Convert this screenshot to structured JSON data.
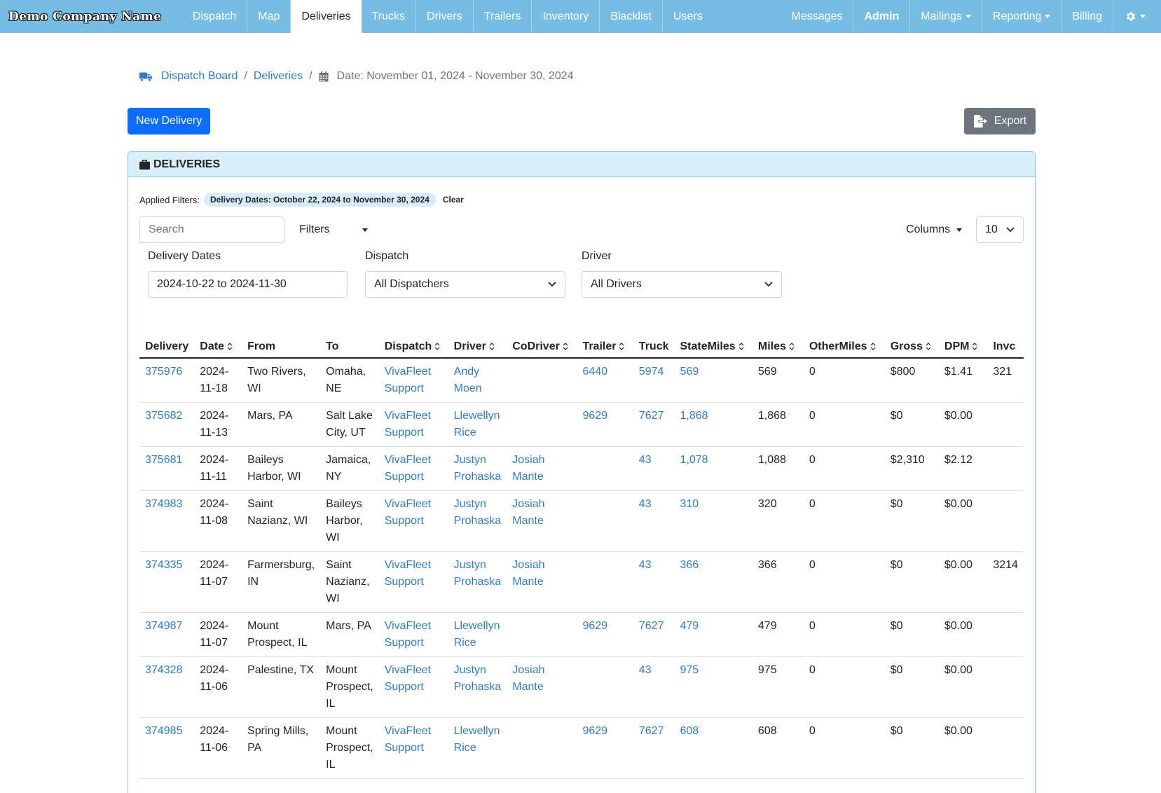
{
  "nav": {
    "brand": "Demo Company Name",
    "left_items": [
      "Dispatch",
      "Map",
      "Deliveries",
      "Trucks",
      "Drivers",
      "Trailers",
      "Inventory",
      "Blacklist",
      "Users"
    ],
    "active": "Deliveries",
    "right_items": [
      "Messages",
      "Admin",
      "Mailings",
      "Reporting",
      "Billing"
    ]
  },
  "breadcrumb": {
    "dispatch_board": "Dispatch Board",
    "deliveries": "Deliveries",
    "date_range": "Date: November 01, 2024 - November 30, 2024"
  },
  "actions": {
    "new_delivery": "New Delivery",
    "export": "Export"
  },
  "card": {
    "title": "DELIVERIES",
    "applied_label": "Applied Filters:",
    "applied_chip": "Delivery Dates: October 22, 2024 to November 30, 2024",
    "clear_label": "Clear",
    "search_placeholder": "Search",
    "filters_label": "Filters",
    "columns_label": "Columns",
    "page_size": "10",
    "delivery_dates_label": "Delivery Dates",
    "delivery_dates_value": "2024-10-22 to 2024-11-30",
    "dispatch_label": "Dispatch",
    "dispatch_value": "All Dispatchers",
    "driver_label": "Driver",
    "driver_value": "All Drivers"
  },
  "table": {
    "columns": [
      "Delivery",
      "Date",
      "From",
      "To",
      "Dispatch",
      "Driver",
      "CoDriver",
      "Trailer",
      "Truck",
      "StateMiles",
      "Miles",
      "OtherMiles",
      "Gross",
      "DPM",
      "Invc"
    ],
    "rows": [
      {
        "delivery": "375976",
        "date": "2024-11-18",
        "from": "Two Rivers, WI",
        "to": "Omaha, NE",
        "dispatch": "VivaFleet Support",
        "driver": "Andy Moen",
        "codriver": "",
        "trailer": "6440",
        "truck": "5974",
        "statemiles": "569",
        "miles": "569",
        "othermiles": "0",
        "gross": "$800",
        "dpm": "$1.41",
        "invoice": "321"
      },
      {
        "delivery": "375682",
        "date": "2024-11-13",
        "from": "Mars, PA",
        "to": "Salt Lake City, UT",
        "dispatch": "VivaFleet Support",
        "driver": "Llewellyn Rice",
        "codriver": "",
        "trailer": "9629",
        "truck": "7627",
        "statemiles": "1,868",
        "miles": "1,868",
        "othermiles": "0",
        "gross": "$0",
        "dpm": "$0.00",
        "invoice": ""
      },
      {
        "delivery": "375681",
        "date": "2024-11-11",
        "from": "Baileys Harbor, WI",
        "to": "Jamaica, NY",
        "dispatch": "VivaFleet Support",
        "driver": "Justyn Prohaska",
        "codriver": "Josiah Mante",
        "trailer": "",
        "truck": "43",
        "statemiles": "1,078",
        "miles": "1,088",
        "othermiles": "0",
        "gross": "$2,310",
        "dpm": "$2.12",
        "invoice": ""
      },
      {
        "delivery": "374983",
        "date": "2024-11-08",
        "from": "Saint Nazianz, WI",
        "to": "Baileys Harbor, WI",
        "dispatch": "VivaFleet Support",
        "driver": "Justyn Prohaska",
        "codriver": "Josiah Mante",
        "trailer": "",
        "truck": "43",
        "statemiles": "310",
        "miles": "320",
        "othermiles": "0",
        "gross": "$0",
        "dpm": "$0.00",
        "invoice": ""
      },
      {
        "delivery": "374335",
        "date": "2024-11-07",
        "from": "Farmersburg, IN",
        "to": "Saint Nazianz, WI",
        "dispatch": "VivaFleet Support",
        "driver": "Justyn Prohaska",
        "codriver": "Josiah Mante",
        "trailer": "",
        "truck": "43",
        "statemiles": "366",
        "miles": "366",
        "othermiles": "0",
        "gross": "$0",
        "dpm": "$0.00",
        "invoice": "3214"
      },
      {
        "delivery": "374987",
        "date": "2024-11-07",
        "from": "Mount Prospect, IL",
        "to": "Mars, PA",
        "dispatch": "VivaFleet Support",
        "driver": "Llewellyn Rice",
        "codriver": "",
        "trailer": "9629",
        "truck": "7627",
        "statemiles": "479",
        "miles": "479",
        "othermiles": "0",
        "gross": "$0",
        "dpm": "$0.00",
        "invoice": ""
      },
      {
        "delivery": "374328",
        "date": "2024-11-06",
        "from": "Palestine, TX",
        "to": "Mount Prospect, IL",
        "dispatch": "VivaFleet Support",
        "driver": "Justyn Prohaska",
        "codriver": "Josiah Mante",
        "trailer": "",
        "truck": "43",
        "statemiles": "975",
        "miles": "975",
        "othermiles": "0",
        "gross": "$0",
        "dpm": "$0.00",
        "invoice": ""
      },
      {
        "delivery": "374985",
        "date": "2024-11-06",
        "from": "Spring Mills, PA",
        "to": "Mount Prospect, IL",
        "dispatch": "VivaFleet Support",
        "driver": "Llewellyn Rice",
        "codriver": "",
        "trailer": "9629",
        "truck": "7627",
        "statemiles": "608",
        "miles": "608",
        "othermiles": "0",
        "gross": "$0",
        "dpm": "$0.00",
        "invoice": ""
      }
    ]
  },
  "colors": {
    "navbar": "#77bde3",
    "link": "#2f7cc4",
    "primary": "#0d6efd",
    "secondary": "#6c757d",
    "card_header": "#d9eef8",
    "card_border": "#7dc7ea"
  }
}
